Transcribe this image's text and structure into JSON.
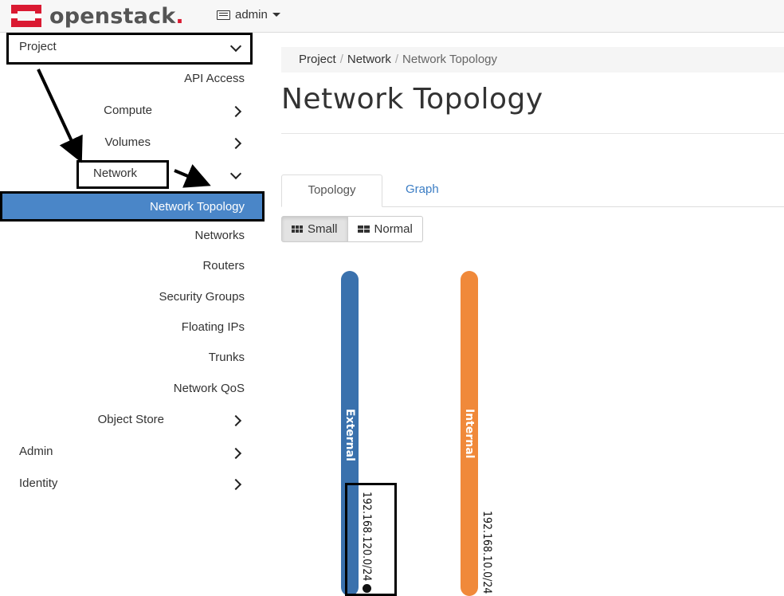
{
  "header": {
    "logo_text": "openstack",
    "logo_dot": ".",
    "project_menu": "admin"
  },
  "sidebar": {
    "project": "Project",
    "api_access": "API Access",
    "compute": "Compute",
    "volumes": "Volumes",
    "network": "Network",
    "network_topology": "Network Topology",
    "networks": "Networks",
    "routers": "Routers",
    "security_groups": "Security Groups",
    "floating_ips": "Floating IPs",
    "trunks": "Trunks",
    "network_qos": "Network QoS",
    "object_store": "Object Store",
    "admin": "Admin",
    "identity": "Identity"
  },
  "breadcrumb": [
    "Project",
    "Network",
    "Network Topology"
  ],
  "page_title": "Network Topology",
  "tabs": {
    "topology": "Topology",
    "graph": "Graph"
  },
  "size_buttons": {
    "small": "Small",
    "normal": "Normal"
  },
  "networks": [
    {
      "name": "External",
      "cidr": "192.168.120.0/24",
      "color": "#3a71ad"
    },
    {
      "name": "Internal",
      "cidr": "192.168.10.0/24",
      "color": "#f0893a"
    }
  ]
}
